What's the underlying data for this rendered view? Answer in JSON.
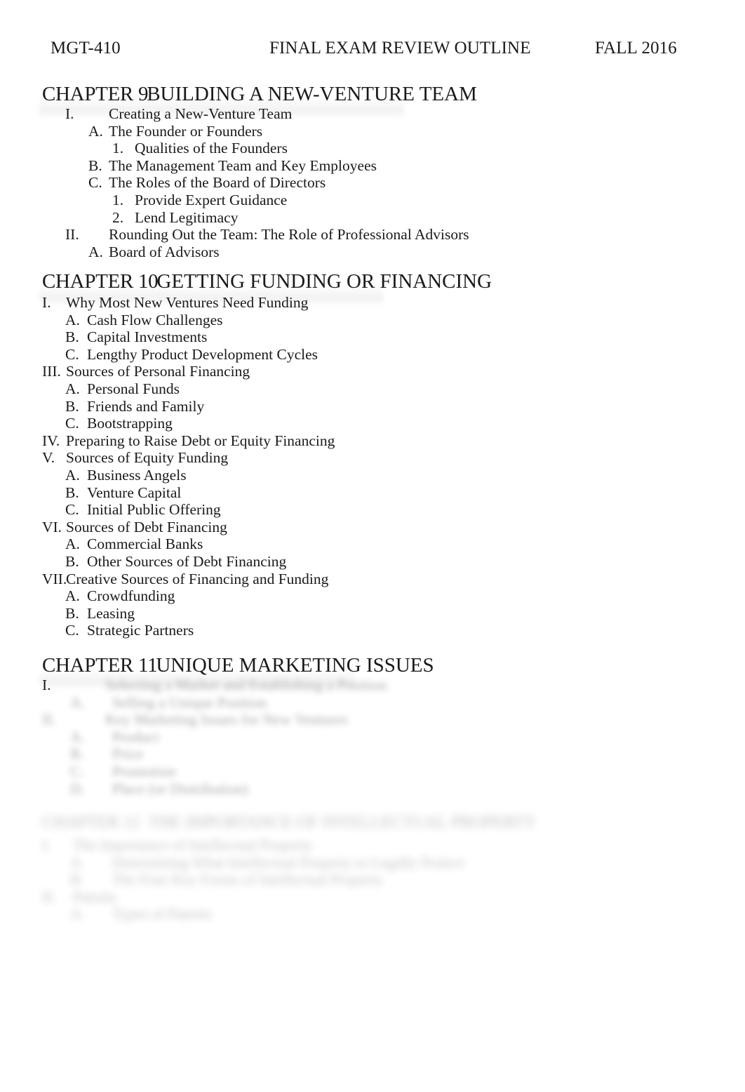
{
  "header": {
    "course": "MGT-410",
    "title": "FINAL EXAM REVIEW OUTLINE",
    "term": "FALL 2016"
  },
  "chapters": [
    {
      "number": "CHAPTER 9",
      "title": "BUILDING A NEW-VENTURE TEAM",
      "visible": true,
      "items": [
        {
          "level": 1,
          "mark": "I.",
          "text": "Creating a New-Venture Team"
        },
        {
          "level": 2,
          "mark": "A.",
          "text": "The Founder or Founders"
        },
        {
          "level": 3,
          "mark": "1.",
          "text": "Qualities of the Founders"
        },
        {
          "level": 2,
          "mark": "B.",
          "text": "The Management Team and Key Employees"
        },
        {
          "level": 2,
          "mark": "C.",
          "text": "The Roles of the Board of Directors"
        },
        {
          "level": 3,
          "mark": "1.",
          "text": "Provide Expert Guidance"
        },
        {
          "level": 3,
          "mark": "2.",
          "text": "Lend Legitimacy"
        },
        {
          "level": 1,
          "mark": "II.",
          "text": "Rounding Out the Team: The Role of Professional Advisors"
        },
        {
          "level": 2,
          "mark": "A.",
          "text": "Board of Advisors"
        }
      ]
    },
    {
      "number": "CHAPTER 10",
      "title": "GETTING FUNDING OR FINANCING",
      "visible": true,
      "items": [
        {
          "level": 1,
          "mark": "I.",
          "text": "Why Most New Ventures Need Funding"
        },
        {
          "level": 2,
          "mark": "A.",
          "text": "Cash Flow Challenges"
        },
        {
          "level": 2,
          "mark": "B.",
          "text": "Capital Investments"
        },
        {
          "level": 2,
          "mark": "C.",
          "text": "Lengthy Product Development Cycles"
        },
        {
          "level": 1,
          "mark": "III.",
          "text": "Sources of Personal Financing"
        },
        {
          "level": 2,
          "mark": "A.",
          "text": "Personal Funds"
        },
        {
          "level": 2,
          "mark": "B.",
          "text": "Friends and Family"
        },
        {
          "level": 2,
          "mark": "C.",
          "text": "Bootstrapping"
        },
        {
          "level": 1,
          "mark": "IV.",
          "text": "Preparing to Raise Debt or Equity Financing"
        },
        {
          "level": 1,
          "mark": "V.",
          "text": "Sources of Equity Funding"
        },
        {
          "level": 2,
          "mark": "A.",
          "text": "Business Angels"
        },
        {
          "level": 2,
          "mark": "B.",
          "text": "Venture Capital"
        },
        {
          "level": 2,
          "mark": "C.",
          "text": "Initial Public Offering"
        },
        {
          "level": 1,
          "mark": "VI.",
          "text": "Sources of Debt Financing"
        },
        {
          "level": 2,
          "mark": "A.",
          "text": "Commercial Banks"
        },
        {
          "level": 2,
          "mark": "B.",
          "text": "Other Sources of Debt Financing"
        },
        {
          "level": 1,
          "mark": "VII.",
          "text": "Creative Sources of Financing and Funding"
        },
        {
          "level": 2,
          "mark": "A.",
          "text": "Crowdfunding"
        },
        {
          "level": 2,
          "mark": "B.",
          "text": "Leasing"
        },
        {
          "level": 2,
          "mark": "C.",
          "text": "Strategic Partners"
        }
      ]
    },
    {
      "number": "CHAPTER 11",
      "title": "UNIQUE MARKETING ISSUES",
      "visible": true,
      "obscured_items": [
        {
          "level": 1,
          "mark": "I.",
          "mark_visible": true,
          "text": "Selecting a Market and Establishing a Position"
        },
        {
          "level": 2,
          "mark": "A.",
          "mark_visible": false,
          "text": "Selling a Unique Position"
        },
        {
          "level": 1,
          "mark": "II.",
          "mark_visible": false,
          "text": "Key Marketing Issues for New Ventures"
        },
        {
          "level": 2,
          "mark": "A.",
          "mark_visible": false,
          "text": "Product"
        },
        {
          "level": 2,
          "mark": "B.",
          "mark_visible": false,
          "text": "Price"
        },
        {
          "level": 2,
          "mark": "C.",
          "mark_visible": false,
          "text": "Promotion"
        },
        {
          "level": 2,
          "mark": "D.",
          "mark_visible": false,
          "text": "Place (or Distribution)"
        }
      ]
    },
    {
      "number": "CHAPTER 12",
      "title": "THE IMPORTANCE OF INTELLECTUAL PROPERTY",
      "visible": false,
      "obscured_items": [
        {
          "level": 1,
          "mark": "I.",
          "mark_visible": false,
          "text": "The Importance of Intellectual Property"
        },
        {
          "level": 2,
          "mark": "A.",
          "mark_visible": false,
          "text": "Determining What Intellectual Property to Legally Protect"
        },
        {
          "level": 2,
          "mark": "B.",
          "mark_visible": false,
          "text": "The Four Key Forms of Intellectual Property"
        },
        {
          "level": 1,
          "mark": "II.",
          "mark_visible": false,
          "text": "Patents"
        },
        {
          "level": 2,
          "mark": "A.",
          "mark_visible": false,
          "text": "Types of Patents"
        }
      ]
    }
  ]
}
